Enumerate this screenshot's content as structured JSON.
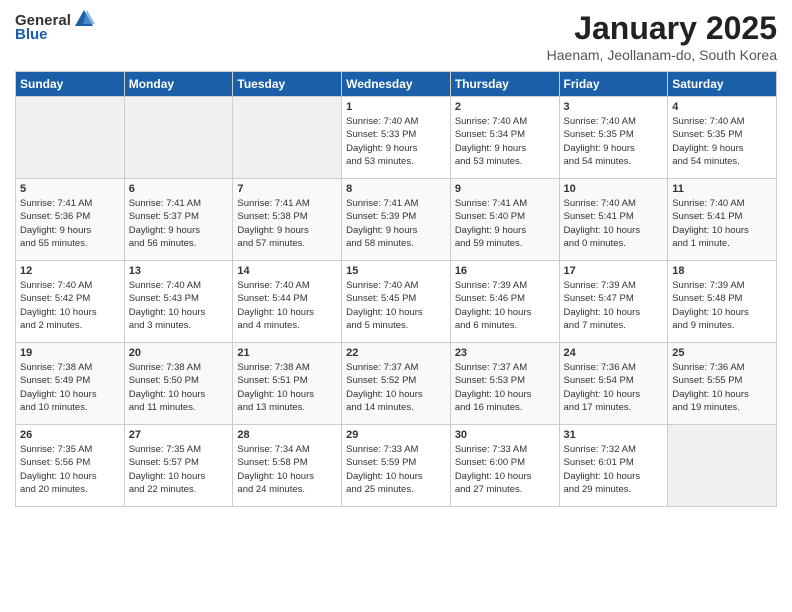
{
  "header": {
    "logo_general": "General",
    "logo_blue": "Blue",
    "title": "January 2025",
    "subtitle": "Haenam, Jeollanam-do, South Korea"
  },
  "days_of_week": [
    "Sunday",
    "Monday",
    "Tuesday",
    "Wednesday",
    "Thursday",
    "Friday",
    "Saturday"
  ],
  "weeks": [
    [
      {
        "day": "",
        "info": ""
      },
      {
        "day": "",
        "info": ""
      },
      {
        "day": "",
        "info": ""
      },
      {
        "day": "1",
        "info": "Sunrise: 7:40 AM\nSunset: 5:33 PM\nDaylight: 9 hours\nand 53 minutes."
      },
      {
        "day": "2",
        "info": "Sunrise: 7:40 AM\nSunset: 5:34 PM\nDaylight: 9 hours\nand 53 minutes."
      },
      {
        "day": "3",
        "info": "Sunrise: 7:40 AM\nSunset: 5:35 PM\nDaylight: 9 hours\nand 54 minutes."
      },
      {
        "day": "4",
        "info": "Sunrise: 7:40 AM\nSunset: 5:35 PM\nDaylight: 9 hours\nand 54 minutes."
      }
    ],
    [
      {
        "day": "5",
        "info": "Sunrise: 7:41 AM\nSunset: 5:36 PM\nDaylight: 9 hours\nand 55 minutes."
      },
      {
        "day": "6",
        "info": "Sunrise: 7:41 AM\nSunset: 5:37 PM\nDaylight: 9 hours\nand 56 minutes."
      },
      {
        "day": "7",
        "info": "Sunrise: 7:41 AM\nSunset: 5:38 PM\nDaylight: 9 hours\nand 57 minutes."
      },
      {
        "day": "8",
        "info": "Sunrise: 7:41 AM\nSunset: 5:39 PM\nDaylight: 9 hours\nand 58 minutes."
      },
      {
        "day": "9",
        "info": "Sunrise: 7:41 AM\nSunset: 5:40 PM\nDaylight: 9 hours\nand 59 minutes."
      },
      {
        "day": "10",
        "info": "Sunrise: 7:40 AM\nSunset: 5:41 PM\nDaylight: 10 hours\nand 0 minutes."
      },
      {
        "day": "11",
        "info": "Sunrise: 7:40 AM\nSunset: 5:41 PM\nDaylight: 10 hours\nand 1 minute."
      }
    ],
    [
      {
        "day": "12",
        "info": "Sunrise: 7:40 AM\nSunset: 5:42 PM\nDaylight: 10 hours\nand 2 minutes."
      },
      {
        "day": "13",
        "info": "Sunrise: 7:40 AM\nSunset: 5:43 PM\nDaylight: 10 hours\nand 3 minutes."
      },
      {
        "day": "14",
        "info": "Sunrise: 7:40 AM\nSunset: 5:44 PM\nDaylight: 10 hours\nand 4 minutes."
      },
      {
        "day": "15",
        "info": "Sunrise: 7:40 AM\nSunset: 5:45 PM\nDaylight: 10 hours\nand 5 minutes."
      },
      {
        "day": "16",
        "info": "Sunrise: 7:39 AM\nSunset: 5:46 PM\nDaylight: 10 hours\nand 6 minutes."
      },
      {
        "day": "17",
        "info": "Sunrise: 7:39 AM\nSunset: 5:47 PM\nDaylight: 10 hours\nand 7 minutes."
      },
      {
        "day": "18",
        "info": "Sunrise: 7:39 AM\nSunset: 5:48 PM\nDaylight: 10 hours\nand 9 minutes."
      }
    ],
    [
      {
        "day": "19",
        "info": "Sunrise: 7:38 AM\nSunset: 5:49 PM\nDaylight: 10 hours\nand 10 minutes."
      },
      {
        "day": "20",
        "info": "Sunrise: 7:38 AM\nSunset: 5:50 PM\nDaylight: 10 hours\nand 11 minutes."
      },
      {
        "day": "21",
        "info": "Sunrise: 7:38 AM\nSunset: 5:51 PM\nDaylight: 10 hours\nand 13 minutes."
      },
      {
        "day": "22",
        "info": "Sunrise: 7:37 AM\nSunset: 5:52 PM\nDaylight: 10 hours\nand 14 minutes."
      },
      {
        "day": "23",
        "info": "Sunrise: 7:37 AM\nSunset: 5:53 PM\nDaylight: 10 hours\nand 16 minutes."
      },
      {
        "day": "24",
        "info": "Sunrise: 7:36 AM\nSunset: 5:54 PM\nDaylight: 10 hours\nand 17 minutes."
      },
      {
        "day": "25",
        "info": "Sunrise: 7:36 AM\nSunset: 5:55 PM\nDaylight: 10 hours\nand 19 minutes."
      }
    ],
    [
      {
        "day": "26",
        "info": "Sunrise: 7:35 AM\nSunset: 5:56 PM\nDaylight: 10 hours\nand 20 minutes."
      },
      {
        "day": "27",
        "info": "Sunrise: 7:35 AM\nSunset: 5:57 PM\nDaylight: 10 hours\nand 22 minutes."
      },
      {
        "day": "28",
        "info": "Sunrise: 7:34 AM\nSunset: 5:58 PM\nDaylight: 10 hours\nand 24 minutes."
      },
      {
        "day": "29",
        "info": "Sunrise: 7:33 AM\nSunset: 5:59 PM\nDaylight: 10 hours\nand 25 minutes."
      },
      {
        "day": "30",
        "info": "Sunrise: 7:33 AM\nSunset: 6:00 PM\nDaylight: 10 hours\nand 27 minutes."
      },
      {
        "day": "31",
        "info": "Sunrise: 7:32 AM\nSunset: 6:01 PM\nDaylight: 10 hours\nand 29 minutes."
      },
      {
        "day": "",
        "info": ""
      }
    ]
  ]
}
